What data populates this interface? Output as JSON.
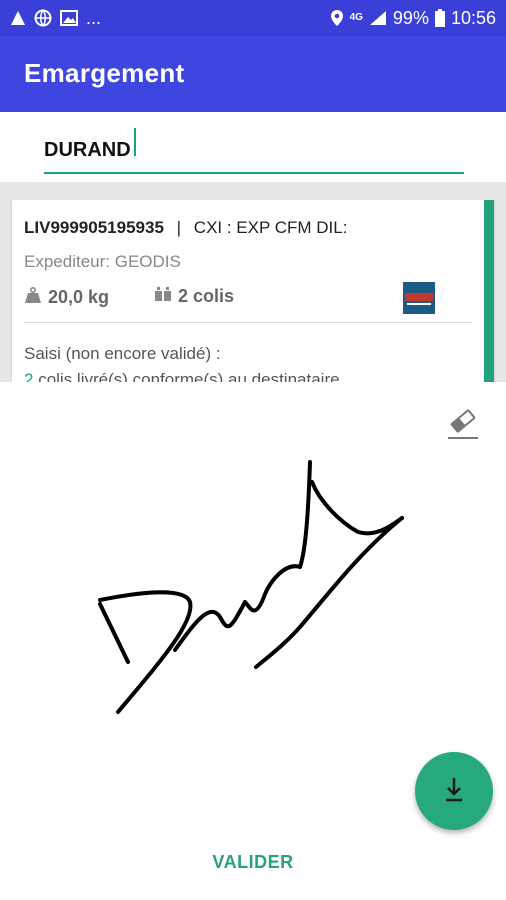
{
  "status_bar": {
    "battery_percent": "99%",
    "time": "10:56",
    "notifications_more": "...",
    "network_label": "4G"
  },
  "app_bar": {
    "title": "Emargement"
  },
  "search": {
    "value": "DURAND"
  },
  "card": {
    "reference": "LIV999905195935",
    "separator": "|",
    "service": "CXI : EXP CFM DIL:",
    "expediteur": "Expediteur: GEODIS",
    "weight": "20,0 kg",
    "colis": "2 colis",
    "status": "Saisi (non encore validé) :",
    "delivered_count": "2",
    "delivered_text": " colis livré(s) conforme(s) au destinataire"
  },
  "actions": {
    "valider_label": "VALIDER"
  },
  "colors": {
    "primary": "#3f46e0",
    "status_bar": "#3a3fd8",
    "accent": "#26a37c"
  },
  "icons": [
    "notification-icon",
    "globe-icon",
    "image-icon",
    "location-icon",
    "signal-icon",
    "battery-icon",
    "weight-icon",
    "boxes-icon",
    "eraser-icon",
    "download-icon"
  ]
}
